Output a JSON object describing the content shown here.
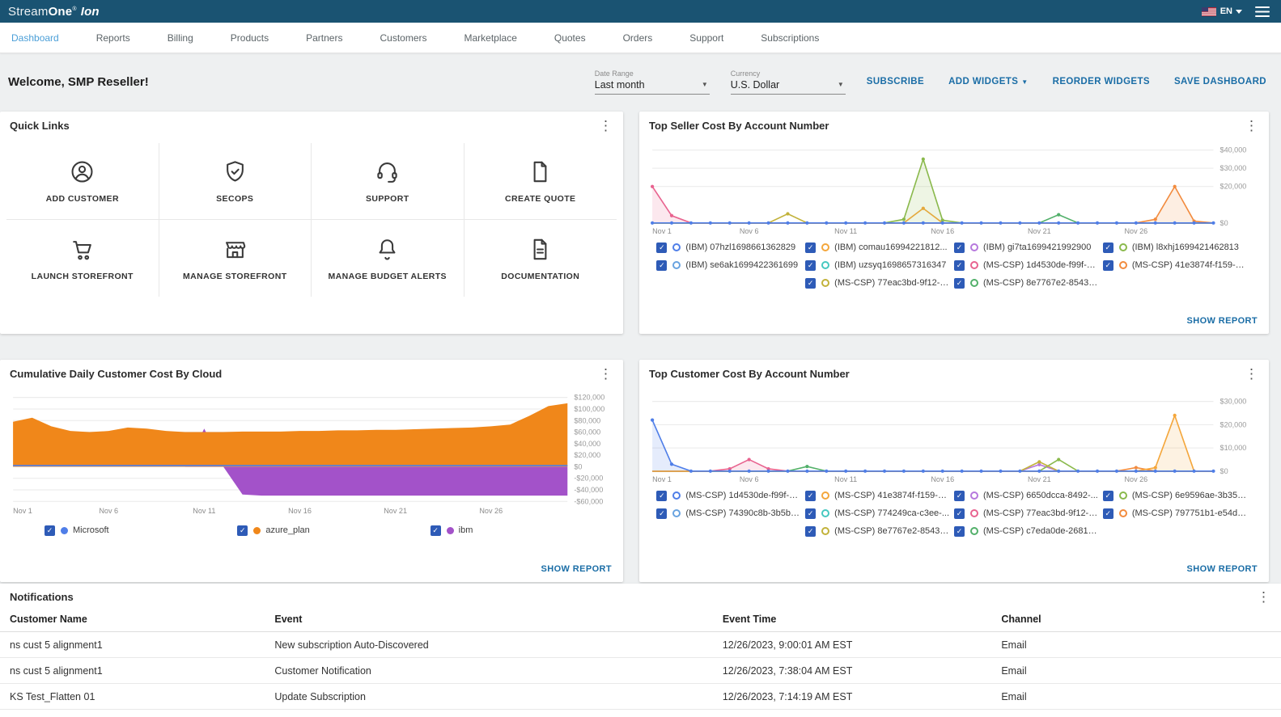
{
  "topbar": {
    "brand": {
      "stream": "Stream",
      "one": "One",
      "reg": "®",
      "ion": "Ion"
    },
    "language": "EN"
  },
  "nav": {
    "items": [
      {
        "label": "Dashboard",
        "active": true
      },
      {
        "label": "Reports"
      },
      {
        "label": "Billing"
      },
      {
        "label": "Products"
      },
      {
        "label": "Partners"
      },
      {
        "label": "Customers"
      },
      {
        "label": "Marketplace"
      },
      {
        "label": "Quotes"
      },
      {
        "label": "Orders"
      },
      {
        "label": "Support"
      },
      {
        "label": "Subscriptions"
      }
    ]
  },
  "header": {
    "welcome": "Welcome, SMP Reseller!",
    "date_range": {
      "label": "Date Range",
      "value": "Last month"
    },
    "currency": {
      "label": "Currency",
      "value": "U.S. Dollar"
    },
    "actions": {
      "subscribe": "SUBSCRIBE",
      "add_widgets": "ADD WIDGETS",
      "reorder": "REORDER WIDGETS",
      "save": "SAVE DASHBOARD"
    }
  },
  "quick_links": {
    "title": "Quick Links",
    "items": [
      {
        "label": "ADD CUSTOMER",
        "icon": "person-circle-icon"
      },
      {
        "label": "SECOPS",
        "icon": "shield-check-icon"
      },
      {
        "label": "SUPPORT",
        "icon": "headset-icon"
      },
      {
        "label": "CREATE QUOTE",
        "icon": "file-icon"
      },
      {
        "label": "LAUNCH STOREFRONT",
        "icon": "cart-icon"
      },
      {
        "label": "MANAGE STOREFRONT",
        "icon": "storefront-icon"
      },
      {
        "label": "MANAGE BUDGET ALERTS",
        "icon": "bell-icon"
      },
      {
        "label": "DOCUMENTATION",
        "icon": "document-icon"
      }
    ]
  },
  "widgets": {
    "top_seller": {
      "title": "Top Seller Cost By Account Number",
      "show_report": "SHOW REPORT"
    },
    "cumulative": {
      "title": "Cumulative Daily Customer Cost By Cloud",
      "show_report": "SHOW REPORT"
    },
    "top_customer": {
      "title": "Top Customer Cost By Account Number",
      "show_report": "SHOW REPORT"
    }
  },
  "chart_data": [
    {
      "id": "top_seller",
      "type": "line",
      "title": "Top Seller Cost By Account Number",
      "legend_style": "ring",
      "x": {
        "days": 30,
        "tick_days": [
          1,
          6,
          11,
          16,
          21,
          26
        ],
        "tick_labels": [
          "Nov 1",
          "Nov 6",
          "Nov 11",
          "Nov 16",
          "Nov 21",
          "Nov 26"
        ]
      },
      "ylim": [
        0,
        42000
      ],
      "yticks": [
        {
          "v": 40000,
          "label": "$40,000"
        },
        {
          "v": 30000,
          "label": "$30,000"
        },
        {
          "v": 20000,
          "label": "$20,000"
        },
        {
          "v": 0,
          "label": "$0"
        }
      ],
      "draw_order": [
        2,
        4,
        5,
        1,
        8,
        9,
        3,
        6,
        7,
        0
      ],
      "series": [
        {
          "name": "(IBM) 07hzl1698661362829",
          "color": "#4f7ee8",
          "markers": "all",
          "peaks": []
        },
        {
          "name": "(IBM) comau16994221812...",
          "color": "#f4a63b",
          "peaks": [
            [
              15,
              8000
            ]
          ]
        },
        {
          "name": "(IBM) gi7ta1699421992900",
          "color": "#b678dd",
          "peaks": []
        },
        {
          "name": "(IBM) l8xhj1699421462813",
          "color": "#8ab94c",
          "fill": true,
          "peaks": [
            [
              14,
              2000
            ],
            [
              15,
              35000
            ],
            [
              16,
              1500
            ]
          ]
        },
        {
          "name": "(IBM) se6ak1699422361699",
          "color": "#69a3e0",
          "peaks": []
        },
        {
          "name": "(IBM) uzsyq1698657316347",
          "color": "#46c8c0",
          "peaks": []
        },
        {
          "name": "(MS-CSP) 1d4530de-f99f-4...",
          "color": "#e8638f",
          "fill": true,
          "peaks": [
            [
              1,
              20000
            ],
            [
              2,
              4000
            ]
          ]
        },
        {
          "name": "(MS-CSP) 41e3874f-f159-4...",
          "color": "#f28b3e",
          "fill": true,
          "peaks": [
            [
              27,
              2000
            ],
            [
              28,
              20000
            ],
            [
              29,
              1000
            ]
          ]
        },
        {
          "name": "(MS-CSP) 77eac3bd-9f12-4...",
          "color": "#c2b23a",
          "peaks": [
            [
              8,
              5000
            ]
          ]
        },
        {
          "name": "(MS-CSP) 8e7767e2-8543-...",
          "color": "#52b06a",
          "peaks": [
            [
              22,
              4500
            ]
          ]
        }
      ]
    },
    {
      "id": "cumulative",
      "type": "area",
      "title": "Cumulative Daily Customer Cost By Cloud",
      "legend_style": "filled",
      "x": {
        "days": 30,
        "tick_days": [
          1,
          6,
          11,
          16,
          21,
          26
        ],
        "tick_labels": [
          "Nov 1",
          "Nov 6",
          "Nov 11",
          "Nov 16",
          "Nov 21",
          "Nov 26"
        ]
      },
      "ylim": [
        -62000,
        125000
      ],
      "yticks": [
        {
          "v": 120000,
          "label": "$120,000"
        },
        {
          "v": 100000,
          "label": "$100,000"
        },
        {
          "v": 80000,
          "label": "$80,000"
        },
        {
          "v": 60000,
          "label": "$60,000"
        },
        {
          "v": 40000,
          "label": "$40,000"
        },
        {
          "v": 20000,
          "label": "$20,000"
        },
        {
          "v": 0,
          "label": "$0"
        },
        {
          "v": -20000,
          "label": "-$20,000"
        },
        {
          "v": -40000,
          "label": "-$40,000"
        },
        {
          "v": -60000,
          "label": "-$60,000"
        }
      ],
      "draw_order": [
        2,
        1,
        0
      ],
      "series": [
        {
          "name": "Microsoft",
          "color": "#4f7ee8",
          "kind": "line",
          "markers": "none",
          "values": [
            2000,
            2000,
            2000,
            2000,
            2000,
            2000,
            2000,
            2000,
            2000,
            2000,
            2000,
            2000,
            2000,
            2000,
            2000,
            2000,
            2000,
            2000,
            2000,
            2000,
            2000,
            2000,
            2000,
            2000,
            2000,
            2000,
            2000,
            2000,
            2000,
            2000
          ]
        },
        {
          "name": "azure_plan",
          "color": "#f0871a",
          "kind": "area",
          "values": [
            78000,
            85000,
            70000,
            62000,
            60000,
            62000,
            68000,
            66000,
            62000,
            60000,
            60000,
            60000,
            61000,
            61000,
            61000,
            62000,
            62000,
            63000,
            63000,
            64000,
            64000,
            65000,
            66000,
            67000,
            68000,
            70000,
            73000,
            88000,
            105000,
            110000
          ]
        },
        {
          "name": "ibm",
          "color": "#a352c9",
          "kind": "area",
          "values": [
            0,
            0,
            0,
            0,
            0,
            0,
            0,
            0,
            0,
            0,
            66000,
            0,
            -48000,
            -50000,
            -50000,
            -50000,
            -50000,
            -50000,
            -50000,
            -50000,
            -50000,
            -50000,
            -50000,
            -50000,
            -50000,
            -50000,
            -50000,
            -50000,
            -50000,
            -50000
          ]
        }
      ]
    },
    {
      "id": "top_customer",
      "type": "line",
      "title": "Top Customer Cost By Account Number",
      "legend_style": "ring",
      "x": {
        "days": 30,
        "tick_days": [
          1,
          6,
          11,
          16,
          21,
          26
        ],
        "tick_labels": [
          "Nov 1",
          "Nov 6",
          "Nov 11",
          "Nov 16",
          "Nov 21",
          "Nov 26"
        ]
      },
      "ylim": [
        0,
        33000
      ],
      "yticks": [
        {
          "v": 30000,
          "label": "$30,000"
        },
        {
          "v": 20000,
          "label": "$20,000"
        },
        {
          "v": 10000,
          "label": "$10,000"
        },
        {
          "v": 0,
          "label": "$0"
        }
      ],
      "draw_order": [
        4,
        5,
        2,
        3,
        7,
        8,
        9,
        6,
        1,
        0
      ],
      "series": [
        {
          "name": "(MS-CSP) 1d4530de-f99f-4...",
          "color": "#4f7ee8",
          "fill": true,
          "markers": "all",
          "peaks": [
            [
              1,
              22000
            ],
            [
              2,
              3000
            ]
          ]
        },
        {
          "name": "(MS-CSP) 41e3874f-f159-4...",
          "color": "#f4a63b",
          "fill": true,
          "peaks": [
            [
              27,
              1500
            ],
            [
              28,
              24000
            ]
          ]
        },
        {
          "name": "(MS-CSP) 6650dcca-8492-...",
          "color": "#b678dd",
          "peaks": [
            [
              21,
              2800
            ]
          ]
        },
        {
          "name": "(MS-CSP) 6e9596ae-3b35-...",
          "color": "#8ab94c",
          "peaks": [
            [
              22,
              5000
            ]
          ]
        },
        {
          "name": "(MS-CSP) 74390c8b-3b5b-...",
          "color": "#69a3e0",
          "peaks": []
        },
        {
          "name": "(MS-CSP) 774249ca-c3ee-...",
          "color": "#46c8c0",
          "peaks": []
        },
        {
          "name": "(MS-CSP) 77eac3bd-9f12-4...",
          "color": "#e8638f",
          "fill": true,
          "peaks": [
            [
              5,
              1000
            ],
            [
              6,
              5000
            ],
            [
              7,
              1000
            ]
          ]
        },
        {
          "name": "(MS-CSP) 797751b1-e54d-...",
          "color": "#f28b3e",
          "peaks": [
            [
              26,
              1500
            ]
          ]
        },
        {
          "name": "(MS-CSP) 8e7767e2-8543-...",
          "color": "#c2b23a",
          "peaks": [
            [
              21,
              4000
            ]
          ]
        },
        {
          "name": "(MS-CSP) c7eda0de-2681-...",
          "color": "#52b06a",
          "peaks": [
            [
              9,
              2000
            ]
          ]
        }
      ]
    }
  ],
  "notifications": {
    "title": "Notifications",
    "columns": [
      "Customer Name",
      "Event",
      "Event Time",
      "Channel"
    ],
    "rows": [
      [
        "ns cust 5 alignment1",
        "New subscription Auto-Discovered",
        "12/26/2023, 9:00:01 AM EST",
        "Email"
      ],
      [
        "ns cust 5 alignment1",
        "Customer Notification",
        "12/26/2023, 7:38:04 AM EST",
        "Email"
      ],
      [
        "KS Test_Flatten 01",
        "Update Subscription",
        "12/26/2023, 7:14:19 AM EST",
        "Email"
      ]
    ]
  }
}
